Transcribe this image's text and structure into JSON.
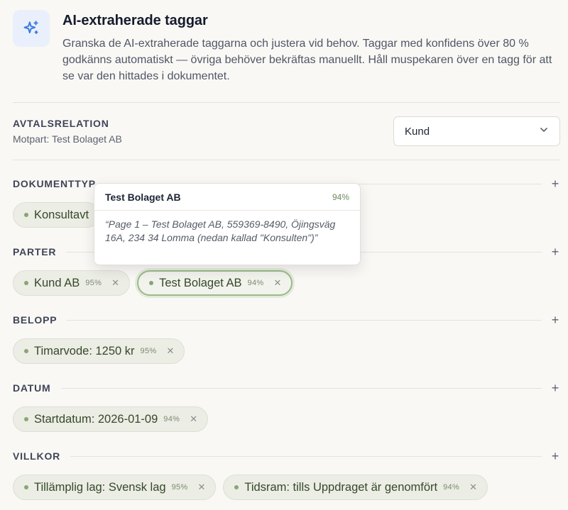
{
  "header": {
    "title": "AI-extraherade taggar",
    "description": "Granska de AI-extraherade taggarna och justera vid behov. Taggar med konfidens över 80 % godkänns automatiskt — övriga behöver bekräftas manuellt. Håll muspekaren över en tagg för att se var den hittades i dokumentet.",
    "icon": "sparkles-icon"
  },
  "relation": {
    "title": "AVTALSRELATION",
    "counterparty": "Motpart: Test Bolaget AB",
    "selected": "Kund"
  },
  "sections": {
    "doctype": {
      "title": "DOKUMENTTYP",
      "tags": [
        {
          "label": "Konsultavt",
          "conf": ""
        }
      ]
    },
    "parter": {
      "title": "PARTER",
      "tags": [
        {
          "label": "Kund AB",
          "conf": "95%"
        },
        {
          "label": "Test Bolaget AB",
          "conf": "94%"
        }
      ]
    },
    "belopp": {
      "title": "BELOPP",
      "tags": [
        {
          "label": "Timarvode: 1250 kr",
          "conf": "95%"
        }
      ]
    },
    "datum": {
      "title": "DATUM",
      "tags": [
        {
          "label": "Startdatum: 2026-01-09",
          "conf": "94%"
        }
      ]
    },
    "villkor": {
      "title": "VILLKOR",
      "tags": [
        {
          "label": "Tillämplig lag: Svensk lag",
          "conf": "95%"
        },
        {
          "label": "Tidsram: tills Uppdraget är genomfört",
          "conf": "94%"
        }
      ]
    }
  },
  "tooltip": {
    "title": "Test Bolaget AB",
    "conf": "94%",
    "quote": "“Page 1 – Test Bolaget AB, 559369-8490, Öjingsväg 16A, 234 34 Lomma (nedan kallad \"Konsulten\")”"
  },
  "colors": {
    "accent": "#3b7be0",
    "tag_bg": "#ecede5",
    "tag_text": "#35492a",
    "dot": "#88a673"
  }
}
